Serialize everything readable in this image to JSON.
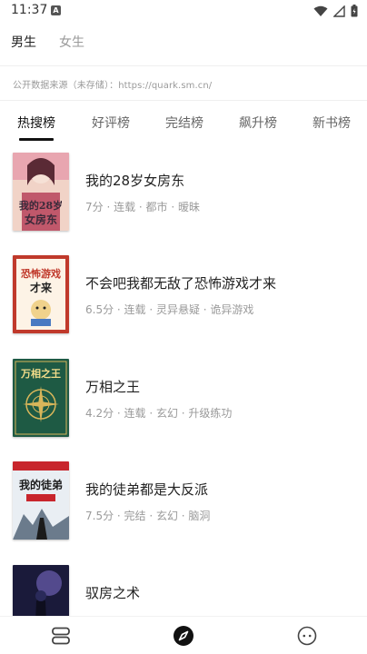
{
  "status": {
    "time": "11:37",
    "notif_glyph": "A"
  },
  "gender_tabs": [
    {
      "label": "男生",
      "active": true
    },
    {
      "label": "女生",
      "active": false
    }
  ],
  "source_note": "公开数据来源（未存储）：https://quark.sm.cn/",
  "rank_tabs": [
    {
      "label": "热搜榜",
      "active": true
    },
    {
      "label": "好评榜",
      "active": false
    },
    {
      "label": "完结榜",
      "active": false
    },
    {
      "label": "飙升榜",
      "active": false
    },
    {
      "label": "新书榜",
      "active": false
    }
  ],
  "books": [
    {
      "title": "我的28岁女房东",
      "meta": "7分 · 连载 · 都市 · 暧昧",
      "cover_text": "我的28岁女房东",
      "cover_colors": [
        "#f3d6c8",
        "#b7425a",
        "#3a2a3a"
      ]
    },
    {
      "title": "不会吧我都无敌了恐怖游戏才来",
      "meta": "6.5分 · 连载 · 灵异悬疑 · 诡异游戏",
      "cover_text": "恐怖游戏才来",
      "cover_colors": [
        "#fdf3e6",
        "#c0392b",
        "#222222"
      ]
    },
    {
      "title": "万相之王",
      "meta": "4.2分 · 连载 · 玄幻 · 升级练功",
      "cover_text": "万相之王",
      "cover_colors": [
        "#1e5a44",
        "#d8b65a",
        "#0f3a2b"
      ]
    },
    {
      "title": "我的徒弟都是大反派",
      "meta": "7.5分 · 完结 · 玄幻 · 脑洞",
      "cover_text": "我的徒弟",
      "cover_colors": [
        "#e9eef3",
        "#6b7b8c",
        "#1b1b1b"
      ]
    },
    {
      "title": "驭房之术",
      "meta": "",
      "cover_text": "",
      "cover_colors": [
        "#2a2a5a",
        "#7a6bc4",
        "#0e0e1e"
      ]
    }
  ],
  "bottom_nav": [
    {
      "icon": "bookshelf-icon",
      "active": false
    },
    {
      "icon": "compass-icon",
      "active": true
    },
    {
      "icon": "smiley-icon",
      "active": false
    }
  ]
}
